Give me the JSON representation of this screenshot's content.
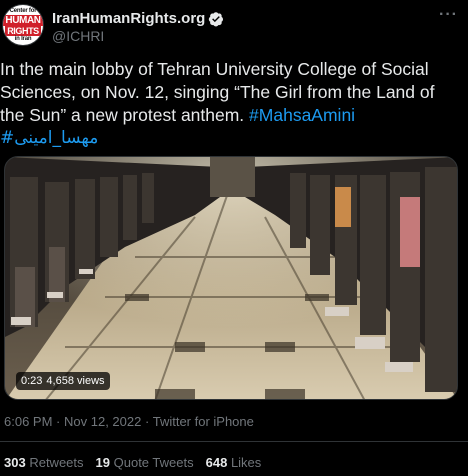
{
  "author": {
    "display_name": "IranHumanRights.org",
    "handle": "@ICHRI",
    "verified_icon": "verified-badge-icon",
    "avatar_text_top": "Center for",
    "avatar_text_mid": "HUMAN",
    "avatar_text_bot": "RIGHTS",
    "avatar_text_tail": "in Iran"
  },
  "tweet": {
    "text": "In the main lobby of Tehran University College of Social Sciences, on Nov. 12, singing “The Girl from the Land of the Sun” a new protest anthem. ",
    "hashtag_en": "#MahsaAmini",
    "hashtag_fa": "#مهسا_امینی"
  },
  "media": {
    "duration": "0:23",
    "views": "4,658 views"
  },
  "meta": {
    "time": "6:06 PM",
    "date": "Nov 12, 2022",
    "source": "Twitter for iPhone",
    "separator": "·"
  },
  "stats": {
    "retweets_count": "303",
    "retweets_label": "Retweets",
    "quotes_count": "19",
    "quotes_label": "Quote Tweets",
    "likes_count": "648",
    "likes_label": "Likes"
  },
  "colors": {
    "background": "#000000",
    "link": "#1d9bf0",
    "secondary": "#71767b",
    "brand_red": "#d0202a"
  },
  "more_icon": "more-horizontal-icon"
}
